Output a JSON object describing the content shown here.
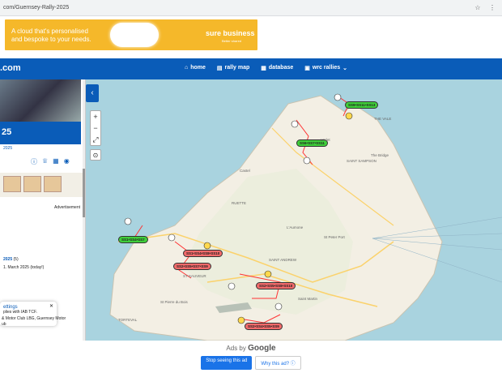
{
  "browser": {
    "url": "com/Guernsey-Rally-2025"
  },
  "ad_top": {
    "line1": "A cloud that's personalised",
    "line2": "and bespoke to your needs.",
    "brand": "sure business",
    "brand_sub": "Better shared"
  },
  "nav": {
    "logo": ".com",
    "menu": [
      "home",
      "rally map",
      "database",
      "wrc rallies"
    ]
  },
  "sidebar": {
    "title": "25",
    "date": "2025",
    "advertisement_label": "Advertisement",
    "meta_year": "2025",
    "meta_count": "(5)",
    "meta_date": "1. March 2025 (today!)",
    "popup_title": "ettings",
    "popup_body": "plies with IAB TCF.",
    "footer_line1": "& Motor Club LBG, Guernsey Motor",
    "footer_line2": "ub"
  },
  "map": {
    "stage_tags": [
      {
        "label": "SS9•SS11•SS13",
        "color": "green"
      },
      {
        "label": "SS6•SS7•SS11",
        "color": "green"
      },
      {
        "label": "SS1•SS4•SS7",
        "color": "green"
      },
      {
        "label": "SS1•SS4•SS8•SS10",
        "color": "red"
      },
      {
        "label": "SS2•SS5•SS7•SS9",
        "color": "red"
      },
      {
        "label": "SS2•SS5•SS8•SS10",
        "color": "red"
      },
      {
        "label": "SS2•SS4•SS5•SS9",
        "color": "red"
      }
    ],
    "places": [
      "L'Islet",
      "The Bridge",
      "THE VALE",
      "St Pierre du Bois",
      "St Peter Port",
      "Saint Martin",
      "Castel",
      "TORTEVAL",
      "ST SAUVEUR",
      "L'Aumone",
      "SAINT ANDREW",
      "RUETTE",
      "SAINT SAMPSON"
    ]
  },
  "ad_bottom": {
    "ads_by": "Ads by",
    "google": "Google",
    "stop": "Stop seeing this ad",
    "why": "Why this ad? ⓘ"
  }
}
